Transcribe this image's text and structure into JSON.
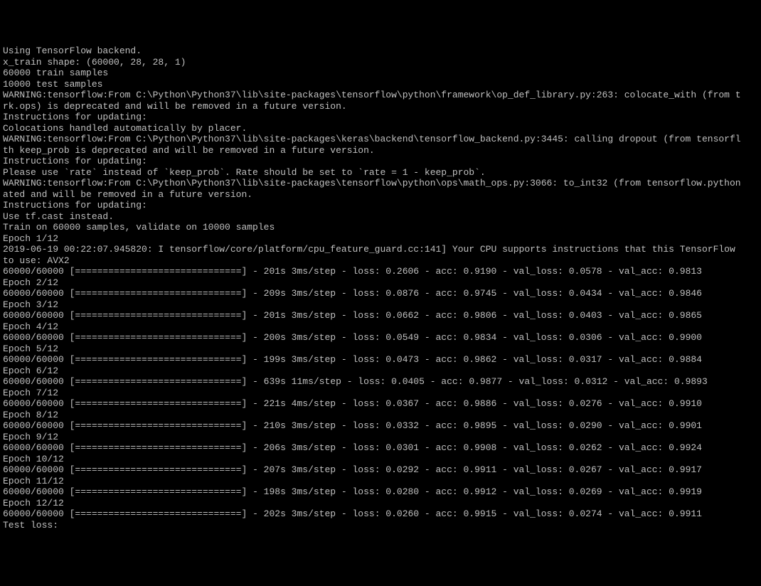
{
  "header": {
    "backend": "Using TensorFlow backend.",
    "x_train_shape": "x_train shape: (60000, 28, 28, 1)",
    "train_samples": "60000 train samples",
    "test_samples": "10000 test samples"
  },
  "warnings": {
    "w1_line1": "WARNING:tensorflow:From C:\\Python\\Python37\\lib\\site-packages\\tensorflow\\python\\framework\\op_def_library.py:263: colocate_with (from t",
    "w1_line2": "rk.ops) is deprecated and will be removed in a future version.",
    "w1_instr": "Instructions for updating:",
    "w1_fix": "Colocations handled automatically by placer.",
    "w2_line1": "WARNING:tensorflow:From C:\\Python\\Python37\\lib\\site-packages\\keras\\backend\\tensorflow_backend.py:3445: calling dropout (from tensorfl",
    "w2_line2": "th keep_prob is deprecated and will be removed in a future version.",
    "w2_instr": "Instructions for updating:",
    "w2_fix": "Please use `rate` instead of `keep_prob`. Rate should be set to `rate = 1 - keep_prob`.",
    "w3_line1": "WARNING:tensorflow:From C:\\Python\\Python37\\lib\\site-packages\\tensorflow\\python\\ops\\math_ops.py:3066: to_int32 (from tensorflow.python",
    "w3_line2": "ated and will be removed in a future version.",
    "w3_instr": "Instructions for updating:",
    "w3_fix": "Use tf.cast instead."
  },
  "training": {
    "train_on": "Train on 60000 samples, validate on 10000 samples",
    "cpu_info": "2019-06-19 00:22:07.945820: I tensorflow/core/platform/cpu_feature_guard.cc:141] Your CPU supports instructions that this TensorFlow",
    "cpu_info2": "to use: AVX2",
    "bar": "60000/60000 [==============================]",
    "epochs": [
      {
        "label": "Epoch 1/12",
        "stats": " - 201s 3ms/step - loss: 0.2606 - acc: 0.9190 - val_loss: 0.0578 - val_acc: 0.9813"
      },
      {
        "label": "Epoch 2/12",
        "stats": " - 209s 3ms/step - loss: 0.0876 - acc: 0.9745 - val_loss: 0.0434 - val_acc: 0.9846"
      },
      {
        "label": "Epoch 3/12",
        "stats": " - 201s 3ms/step - loss: 0.0662 - acc: 0.9806 - val_loss: 0.0403 - val_acc: 0.9865"
      },
      {
        "label": "Epoch 4/12",
        "stats": " - 200s 3ms/step - loss: 0.0549 - acc: 0.9834 - val_loss: 0.0306 - val_acc: 0.9900"
      },
      {
        "label": "Epoch 5/12",
        "stats": " - 199s 3ms/step - loss: 0.0473 - acc: 0.9862 - val_loss: 0.0317 - val_acc: 0.9884"
      },
      {
        "label": "Epoch 6/12",
        "stats": " - 639s 11ms/step - loss: 0.0405 - acc: 0.9877 - val_loss: 0.0312 - val_acc: 0.9893"
      },
      {
        "label": "Epoch 7/12",
        "stats": " - 221s 4ms/step - loss: 0.0367 - acc: 0.9886 - val_loss: 0.0276 - val_acc: 0.9910"
      },
      {
        "label": "Epoch 8/12",
        "stats": " - 210s 3ms/step - loss: 0.0332 - acc: 0.9895 - val_loss: 0.0290 - val_acc: 0.9901"
      },
      {
        "label": "Epoch 9/12",
        "stats": " - 206s 3ms/step - loss: 0.0301 - acc: 0.9908 - val_loss: 0.0262 - val_acc: 0.9924"
      },
      {
        "label": "Epoch 10/12",
        "stats": " - 207s 3ms/step - loss: 0.0292 - acc: 0.9911 - val_loss: 0.0267 - val_acc: 0.9917"
      },
      {
        "label": "Epoch 11/12",
        "stats": " - 198s 3ms/step - loss: 0.0280 - acc: 0.9912 - val_loss: 0.0269 - val_acc: 0.9919"
      },
      {
        "label": "Epoch 12/12",
        "stats": " - 202s 3ms/step - loss: 0.0260 - acc: 0.9915 - val_loss: 0.0274 - val_acc: 0.9911"
      }
    ],
    "final": "Test loss:"
  },
  "chart_data": {
    "type": "table",
    "title": "Keras MNIST CNN training log (12 epochs)",
    "columns": [
      "epoch",
      "time_s",
      "ms_per_step",
      "loss",
      "acc",
      "val_loss",
      "val_acc"
    ],
    "rows": [
      [
        1,
        201,
        3,
        0.2606,
        0.919,
        0.0578,
        0.9813
      ],
      [
        2,
        209,
        3,
        0.0876,
        0.9745,
        0.0434,
        0.9846
      ],
      [
        3,
        201,
        3,
        0.0662,
        0.9806,
        0.0403,
        0.9865
      ],
      [
        4,
        200,
        3,
        0.0549,
        0.9834,
        0.0306,
        0.99
      ],
      [
        5,
        199,
        3,
        0.0473,
        0.9862,
        0.0317,
        0.9884
      ],
      [
        6,
        639,
        11,
        0.0405,
        0.9877,
        0.0312,
        0.9893
      ],
      [
        7,
        221,
        4,
        0.0367,
        0.9886,
        0.0276,
        0.991
      ],
      [
        8,
        210,
        3,
        0.0332,
        0.9895,
        0.029,
        0.9901
      ],
      [
        9,
        206,
        3,
        0.0301,
        0.9908,
        0.0262,
        0.9924
      ],
      [
        10,
        207,
        3,
        0.0292,
        0.9911,
        0.0267,
        0.9917
      ],
      [
        11,
        198,
        3,
        0.028,
        0.9912,
        0.0269,
        0.9919
      ],
      [
        12,
        202,
        3,
        0.026,
        0.9915,
        0.0274,
        0.9911
      ]
    ]
  }
}
